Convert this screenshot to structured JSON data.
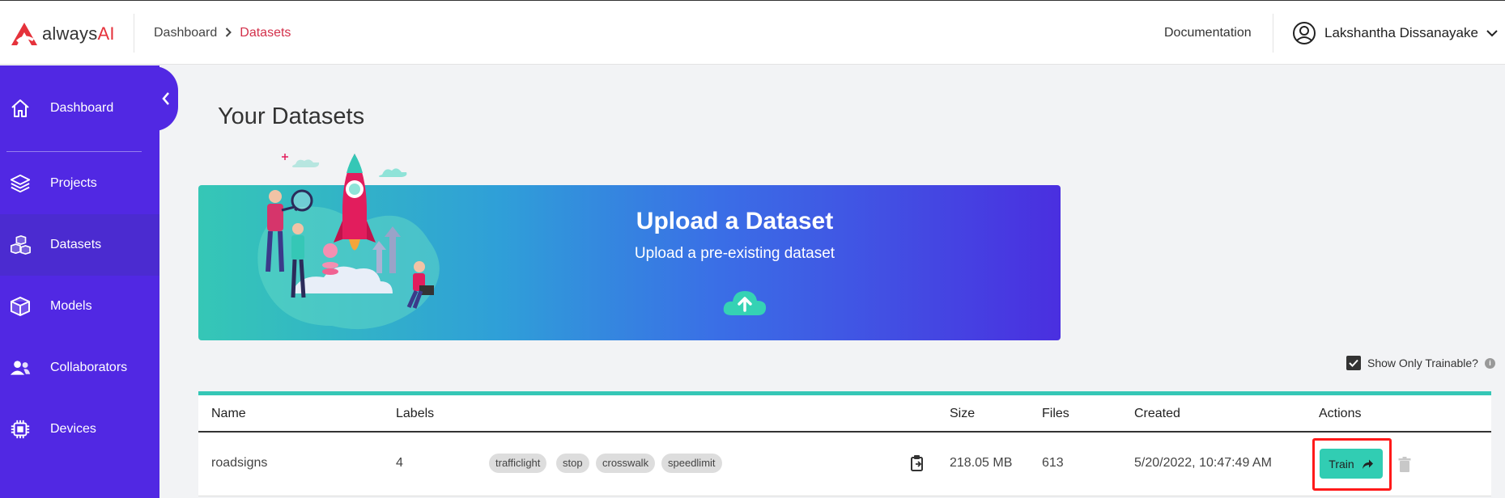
{
  "header": {
    "logo": {
      "text_prefix": "always",
      "text_suffix": "AI"
    },
    "breadcrumb": [
      "Dashboard",
      "Datasets"
    ],
    "documentation_label": "Documentation",
    "user_name": "Lakshantha Dissanayake"
  },
  "sidebar": {
    "items": [
      {
        "label": "Dashboard",
        "icon": "home-icon"
      },
      {
        "label": "Projects",
        "icon": "layers-icon"
      },
      {
        "label": "Datasets",
        "icon": "cubes-icon",
        "active": true
      },
      {
        "label": "Models",
        "icon": "box-icon"
      },
      {
        "label": "Collaborators",
        "icon": "users-icon"
      },
      {
        "label": "Devices",
        "icon": "chip-icon"
      }
    ]
  },
  "main": {
    "title": "Your Datasets",
    "banner": {
      "title": "Upload a Dataset",
      "subtitle": "Upload a pre-existing dataset"
    },
    "show_trainable_label": "Show Only Trainable?",
    "show_trainable_checked": true,
    "table": {
      "columns": [
        "Name",
        "Labels",
        "Size",
        "Files",
        "Created",
        "Actions"
      ],
      "rows": [
        {
          "name": "roadsigns",
          "label_count": "4",
          "labels": [
            "trafficlight",
            "stop",
            "crosswalk",
            "speedlimit"
          ],
          "size": "218.05 MB",
          "files": "613",
          "created": "5/20/2022, 10:47:49 AM",
          "train_label": "Train"
        }
      ]
    }
  },
  "colors": {
    "sidebar": "#5128e3",
    "accent_red": "#e5323b",
    "teal": "#35c7b6",
    "train_button": "#31cdb3"
  }
}
